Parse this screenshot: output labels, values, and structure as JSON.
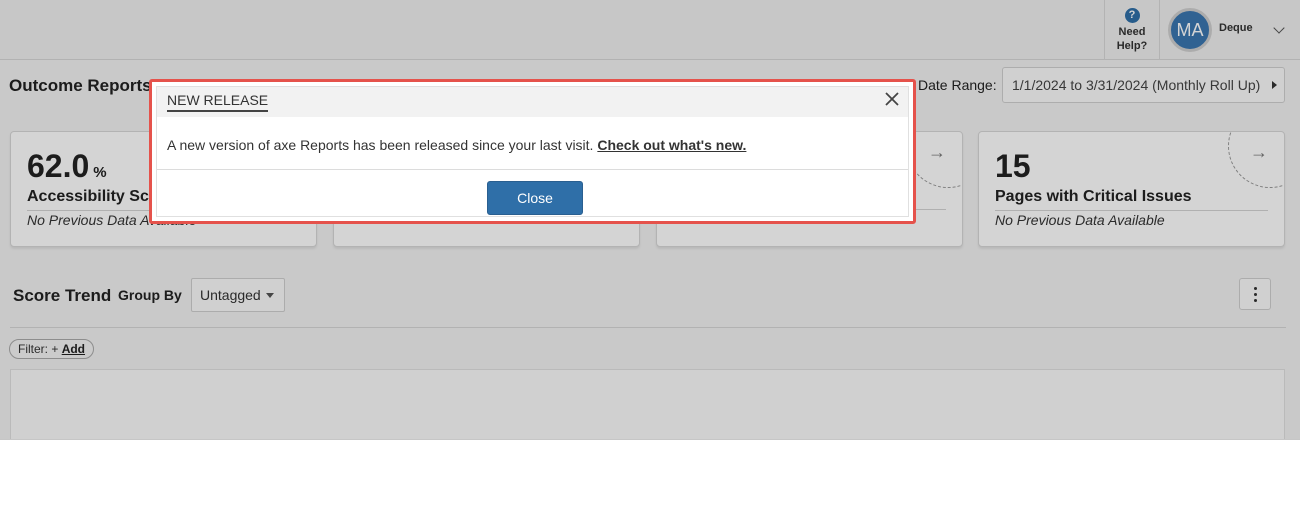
{
  "topbar": {
    "help_label": "Need Help?",
    "help_icon": "question-circle-icon",
    "avatar_initials": "MA",
    "user_name": "Deque"
  },
  "header": {
    "title": "Outcome Reports",
    "date_range_label": "Date Range:",
    "date_range_value": "1/1/2024 to 3/31/2024 (Monthly Roll Up)"
  },
  "cards": [
    {
      "value": "62.0",
      "unit": "%",
      "label": "Accessibility Score",
      "sub": "No Previous Data Available"
    },
    {
      "value": "",
      "unit": "",
      "label": "",
      "sub": ""
    },
    {
      "value": "",
      "unit": "",
      "label": "",
      "sub": ""
    },
    {
      "value": "15",
      "unit": "",
      "label": "Pages with Critical Issues",
      "sub": "No Previous Data Available"
    }
  ],
  "trend": {
    "title": "Score Trend",
    "group_by_label": "Group By",
    "group_by_value": "Untagged",
    "filter_prefix": "Filter: +",
    "filter_add": "Add"
  },
  "modal": {
    "title": "NEW RELEASE",
    "body_text": "A new version of axe Reports has been released since your last visit. ",
    "body_link": "Check out what's new.",
    "close_label": "Close"
  },
  "colors": {
    "primary": "#2f6fa8",
    "highlight_border": "#e5524b"
  }
}
